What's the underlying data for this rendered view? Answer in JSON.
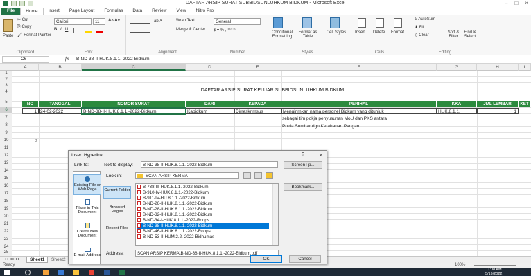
{
  "window": {
    "title": "DAFTAR ARSIP SURAT SUBBIDSUNLUHKUM BIDKUM  -  Microsoft Excel",
    "controls": [
      "–",
      "□",
      "×"
    ]
  },
  "tabs": [
    "File",
    "Home",
    "Insert",
    "Page Layout",
    "Formulas",
    "Data",
    "Review",
    "View",
    "Nitro Pro"
  ],
  "ribbon": {
    "clipboard": {
      "cut": "Cut",
      "copy": "Copy",
      "paste": "Paste",
      "format_painter": "Format Painter",
      "label": "Clipboard"
    },
    "font": {
      "name": "Calibri",
      "size": "11",
      "label": "Font"
    },
    "alignment": {
      "wrap": "Wrap Text",
      "merge": "Merge & Center",
      "label": "Alignment"
    },
    "number": {
      "format": "General",
      "label": "Number"
    },
    "styles": {
      "conditional": "Conditional Formatting",
      "format_table": "Format as Table",
      "cell_styles": "Cell Styles",
      "label": "Styles"
    },
    "cells": {
      "insert": "Insert",
      "delete": "Delete",
      "format": "Format",
      "label": "Cells"
    },
    "editing": {
      "autosum": "AutoSum",
      "fill": "Fill",
      "clear": "Clear",
      "sort": "Sort & Filter",
      "find": "Find & Select",
      "label": "Editing"
    }
  },
  "formula_bar": {
    "name_box": "C6",
    "fx": "fx",
    "formula": "B-ND-38-II-HUK.8.1.1.-2022-Bidkum"
  },
  "columns": [
    "A",
    "B",
    "C",
    "D",
    "E",
    "F",
    "G",
    "H",
    "I"
  ],
  "rows": [
    "1",
    "2",
    "3",
    "4",
    "5",
    "6",
    "7",
    "8",
    "9",
    "10",
    "11",
    "12",
    "13",
    "14",
    "15",
    "16",
    "17",
    "18",
    "19",
    "20",
    "21",
    "22",
    "23",
    "24",
    "25"
  ],
  "sheet": {
    "title": "DAFTAR ARSIP SURAT KELUAR SUBBIDSUNLUHKUM BIDKUM",
    "headers": [
      "NO",
      "TANGGAL",
      "NOMOR SURAT",
      "DARI",
      "KEPADA",
      "PERIHAL",
      "KKA",
      "JML LEMBAR",
      "KET"
    ],
    "row6": {
      "no": "1",
      "tanggal": "24-02-2022",
      "nomor": "B-ND-38-II-HUK.8.1.1.-2022-Bidkum",
      "dari": "Kabidkum",
      "kepada": "Dirreskrimsus",
      "perihal": "Mengirimkan nama personel Bidkum yang ditunjuk",
      "kka": "HUK.8.1.1.",
      "jml": "1"
    },
    "row7_perihal": "sebagai tim pokja penyusunan MoU dan PKS antara",
    "row8_perihal": "Polda Sumbar dgn Ketahanan Pangan",
    "row10_no": "2"
  },
  "sheet_tabs": [
    "Sheet1",
    "Sheet2"
  ],
  "status": {
    "ready": "Ready",
    "zoom": "100%"
  },
  "taskbar": {
    "time": "11:08 AM",
    "date": "5/19/2022"
  },
  "dialog": {
    "title": "Insert Hyperlink",
    "help": "?",
    "close": "×",
    "link_to_label": "Link to:",
    "text_display_label": "Text to display:",
    "text_display_value": "B-ND-38-II-HUK.8.1.1.-2022-Bidkum",
    "screentip": "ScreenTip...",
    "look_in_label": "Look in:",
    "look_in_value": "SCAN ARSIP KERMA",
    "bookmark": "Bookmark...",
    "link_options": [
      "Existing File or Web Page",
      "Place in This Document",
      "Create New Document",
      "E-mail Address"
    ],
    "nav_options": [
      "Current Folder",
      "Browsed Pages",
      "Recent Files"
    ],
    "files": [
      "B-738-III-HUK.8.1.1.-2022-Bidkum",
      "B-910-IV-HUK.8.1.1.-2022-Bidkum",
      "B-911-IV-HU.8.1.1.-2022-Bidkum",
      "B-ND-26-II-HUK.8.1.1.-2022-Bidkum",
      "B-ND-28-II-HUK.8.1.1.-2022-Bidkum",
      "B-ND-32-II-HUK.8.1.1.-2022-Bidkum",
      "B-ND-34-I-HUK.8.1.1.-2022-Roops",
      "B-ND-38-II-HUK.8.1.1.-2022-Bidkum",
      "B-ND-46-II-HUK.8.1.1.-2022-Roops",
      "B-ND-53-II-HUM.2.2.-2022-Bidhumas"
    ],
    "selected_file_index": 7,
    "address_label": "Address:",
    "address_value": "SCAN ARSIP KERMA\\B-ND-38-II-HUK.8.1.1.-2022-Bidkum.pdf",
    "ok": "OK",
    "cancel": "Cancel"
  }
}
